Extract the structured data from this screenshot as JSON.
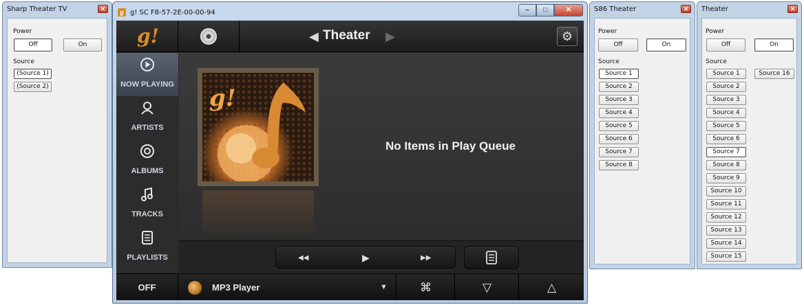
{
  "sharp_dialog": {
    "title": "Sharp Theater TV",
    "power_label": "Power",
    "off": "Off",
    "on": "On",
    "source_label": "Source",
    "sources": [
      "(Source 1)",
      "(Source 2)"
    ]
  },
  "main_window": {
    "title": "g! SC F8-57-2E-00-00-94",
    "top": {
      "logo": "g!",
      "zone_title": "Theater"
    },
    "nav": [
      {
        "label": "NOW PLAYING",
        "icon": "play-circle-icon"
      },
      {
        "label": "ARTISTS",
        "icon": "artist-icon"
      },
      {
        "label": "ALBUMS",
        "icon": "disc-icon"
      },
      {
        "label": "TRACKS",
        "icon": "music-note-icon"
      },
      {
        "label": "PLAYLISTS",
        "icon": "playlist-icon"
      }
    ],
    "now_playing_message": "No Items in Play Queue",
    "bottom": {
      "power": "OFF",
      "source_name": "MP3 Player"
    },
    "colors": {
      "accent": "#e08a22",
      "background": "#2a2a2a"
    }
  },
  "s86_dialog": {
    "title": "S86 Theater",
    "power_label": "Power",
    "off": "Off",
    "on": "On",
    "source_label": "Source",
    "sources": [
      "Source 1",
      "Source 2",
      "Source 3",
      "Source 4",
      "Source 5",
      "Source 6",
      "Source 7",
      "Source 8"
    ]
  },
  "theater_dialog": {
    "title": "Theater",
    "power_label": "Power",
    "off": "Off",
    "on": "On",
    "source_label": "Source",
    "sources": [
      "Source 1",
      "Source 2",
      "Source 3",
      "Source 4",
      "Source 5",
      "Source 6",
      "Source 7",
      "Source 8",
      "Source 9",
      "Source 10",
      "Source 11",
      "Source 12",
      "Source 13",
      "Source 14",
      "Source 15",
      "Source 16"
    ]
  }
}
